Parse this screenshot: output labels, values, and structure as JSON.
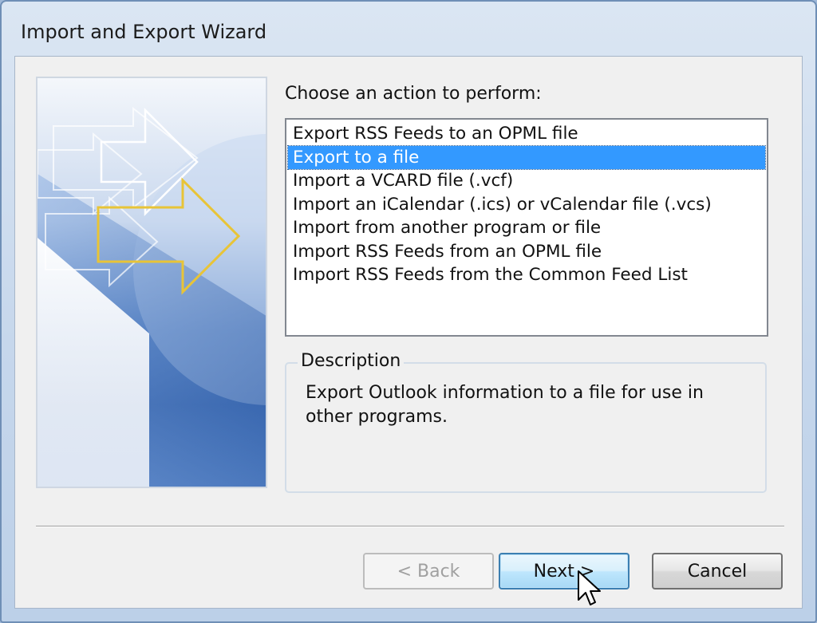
{
  "window": {
    "title": "Import and Export Wizard"
  },
  "prompt": "Choose an action to perform:",
  "actions": {
    "items": [
      {
        "label": "Export RSS Feeds to an OPML file",
        "selected": false
      },
      {
        "label": "Export to a file",
        "selected": true
      },
      {
        "label": "Import a VCARD file (.vcf)",
        "selected": false
      },
      {
        "label": "Import an iCalendar (.ics) or vCalendar file (.vcs)",
        "selected": false
      },
      {
        "label": "Import from another program or file",
        "selected": false
      },
      {
        "label": "Import RSS Feeds from an OPML file",
        "selected": false
      },
      {
        "label": "Import RSS Feeds from the Common Feed List",
        "selected": false
      }
    ]
  },
  "description": {
    "legend": "Description",
    "text": "Export Outlook information to a file for use in other programs."
  },
  "buttons": {
    "back": "< Back",
    "next": "Next >",
    "cancel": "Cancel"
  },
  "colors": {
    "selection": "#3399ff",
    "banner_arrow_accent": "#e8c437",
    "title_bar": "#c6d7ec"
  },
  "icons": {
    "banner": "import-export-arrows-graphic",
    "cursor": "mouse-pointer-icon"
  }
}
